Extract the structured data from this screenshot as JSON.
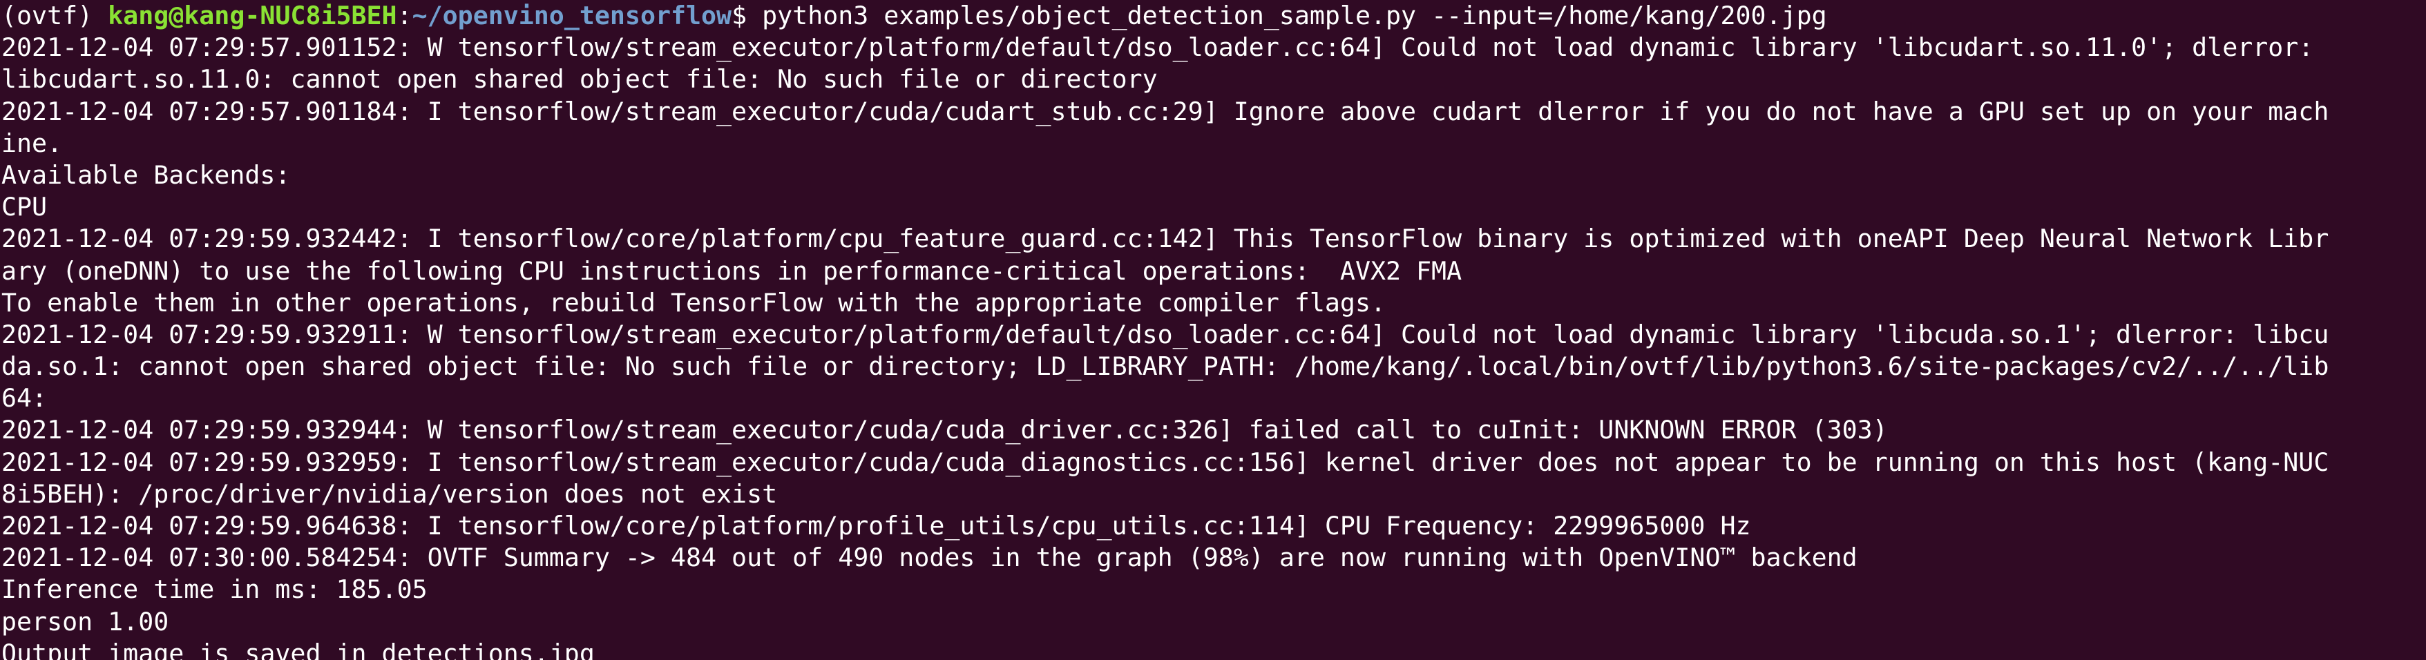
{
  "terminal": {
    "prompt": {
      "env": "(ovtf) ",
      "user_host": "kang@kang-NUC8i5BEH",
      "colon": ":",
      "path": "~/openvino_tensorflow",
      "symbol": "$ ",
      "command": "python3 examples/object_detection_sample.py --input=/home/kang/200.jpg"
    },
    "output_lines": [
      "2021-12-04 07:29:57.901152: W tensorflow/stream_executor/platform/default/dso_loader.cc:64] Could not load dynamic library 'libcudart.so.11.0'; dlerror:",
      "libcudart.so.11.0: cannot open shared object file: No such file or directory",
      "2021-12-04 07:29:57.901184: I tensorflow/stream_executor/cuda/cudart_stub.cc:29] Ignore above cudart dlerror if you do not have a GPU set up on your mach",
      "ine.",
      "Available Backends:",
      "CPU",
      "2021-12-04 07:29:59.932442: I tensorflow/core/platform/cpu_feature_guard.cc:142] This TensorFlow binary is optimized with oneAPI Deep Neural Network Libr",
      "ary (oneDNN) to use the following CPU instructions in performance-critical operations:  AVX2 FMA",
      "To enable them in other operations, rebuild TensorFlow with the appropriate compiler flags.",
      "2021-12-04 07:29:59.932911: W tensorflow/stream_executor/platform/default/dso_loader.cc:64] Could not load dynamic library 'libcuda.so.1'; dlerror: libcu",
      "da.so.1: cannot open shared object file: No such file or directory; LD_LIBRARY_PATH: /home/kang/.local/bin/ovtf/lib/python3.6/site-packages/cv2/../../lib",
      "64:",
      "2021-12-04 07:29:59.932944: W tensorflow/stream_executor/cuda/cuda_driver.cc:326] failed call to cuInit: UNKNOWN ERROR (303)",
      "2021-12-04 07:29:59.932959: I tensorflow/stream_executor/cuda/cuda_diagnostics.cc:156] kernel driver does not appear to be running on this host (kang-NUC",
      "8i5BEH): /proc/driver/nvidia/version does not exist",
      "2021-12-04 07:29:59.964638: I tensorflow/core/platform/profile_utils/cpu_utils.cc:114] CPU Frequency: 2299965000 Hz",
      "2021-12-04 07:30:00.584254: OVTF Summary -> 484 out of 490 nodes in the graph (98%) are now running with OpenVINO™ backend",
      "Inference time in ms: 185.05",
      "person 1.00",
      "Output image is saved in detections.jpg"
    ],
    "colors": {
      "background": "#300a24",
      "text": "#ffffff",
      "user_host": "#8ae234",
      "path": "#729fcf"
    }
  }
}
